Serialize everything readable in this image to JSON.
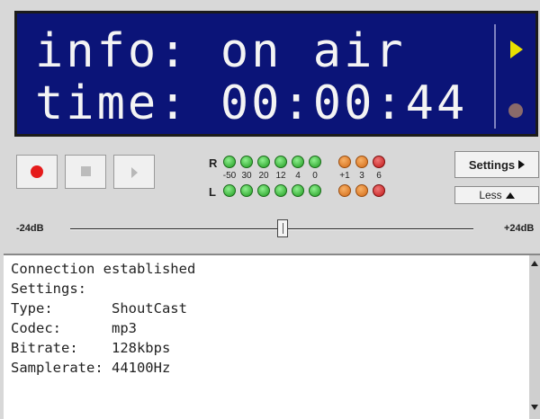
{
  "display": {
    "info_line": "info: on air",
    "time_line": "time: 00:00:44"
  },
  "transport": {
    "record_icon": "record-icon",
    "stop_icon": "stop-icon",
    "play_icon": "play-icon"
  },
  "meter": {
    "right_label": "R",
    "left_label": "L",
    "scale": [
      "-50",
      "30",
      "20",
      "12",
      "4",
      "0",
      "+1",
      "3",
      "6"
    ],
    "led_colors": [
      "green",
      "green",
      "green",
      "green",
      "green",
      "green",
      "orange",
      "orange",
      "red"
    ]
  },
  "buttons": {
    "settings_label": "Settings",
    "less_label": "Less"
  },
  "volume": {
    "min_label": "-24dB",
    "max_label": "+24dB",
    "level_fraction": 0.5
  },
  "log": {
    "lines": [
      "Connection established",
      "Settings:",
      "Type:       ShoutCast",
      "Codec:      mp3",
      "Bitrate:    128kbps",
      "Samplerate: 44100Hz"
    ]
  }
}
